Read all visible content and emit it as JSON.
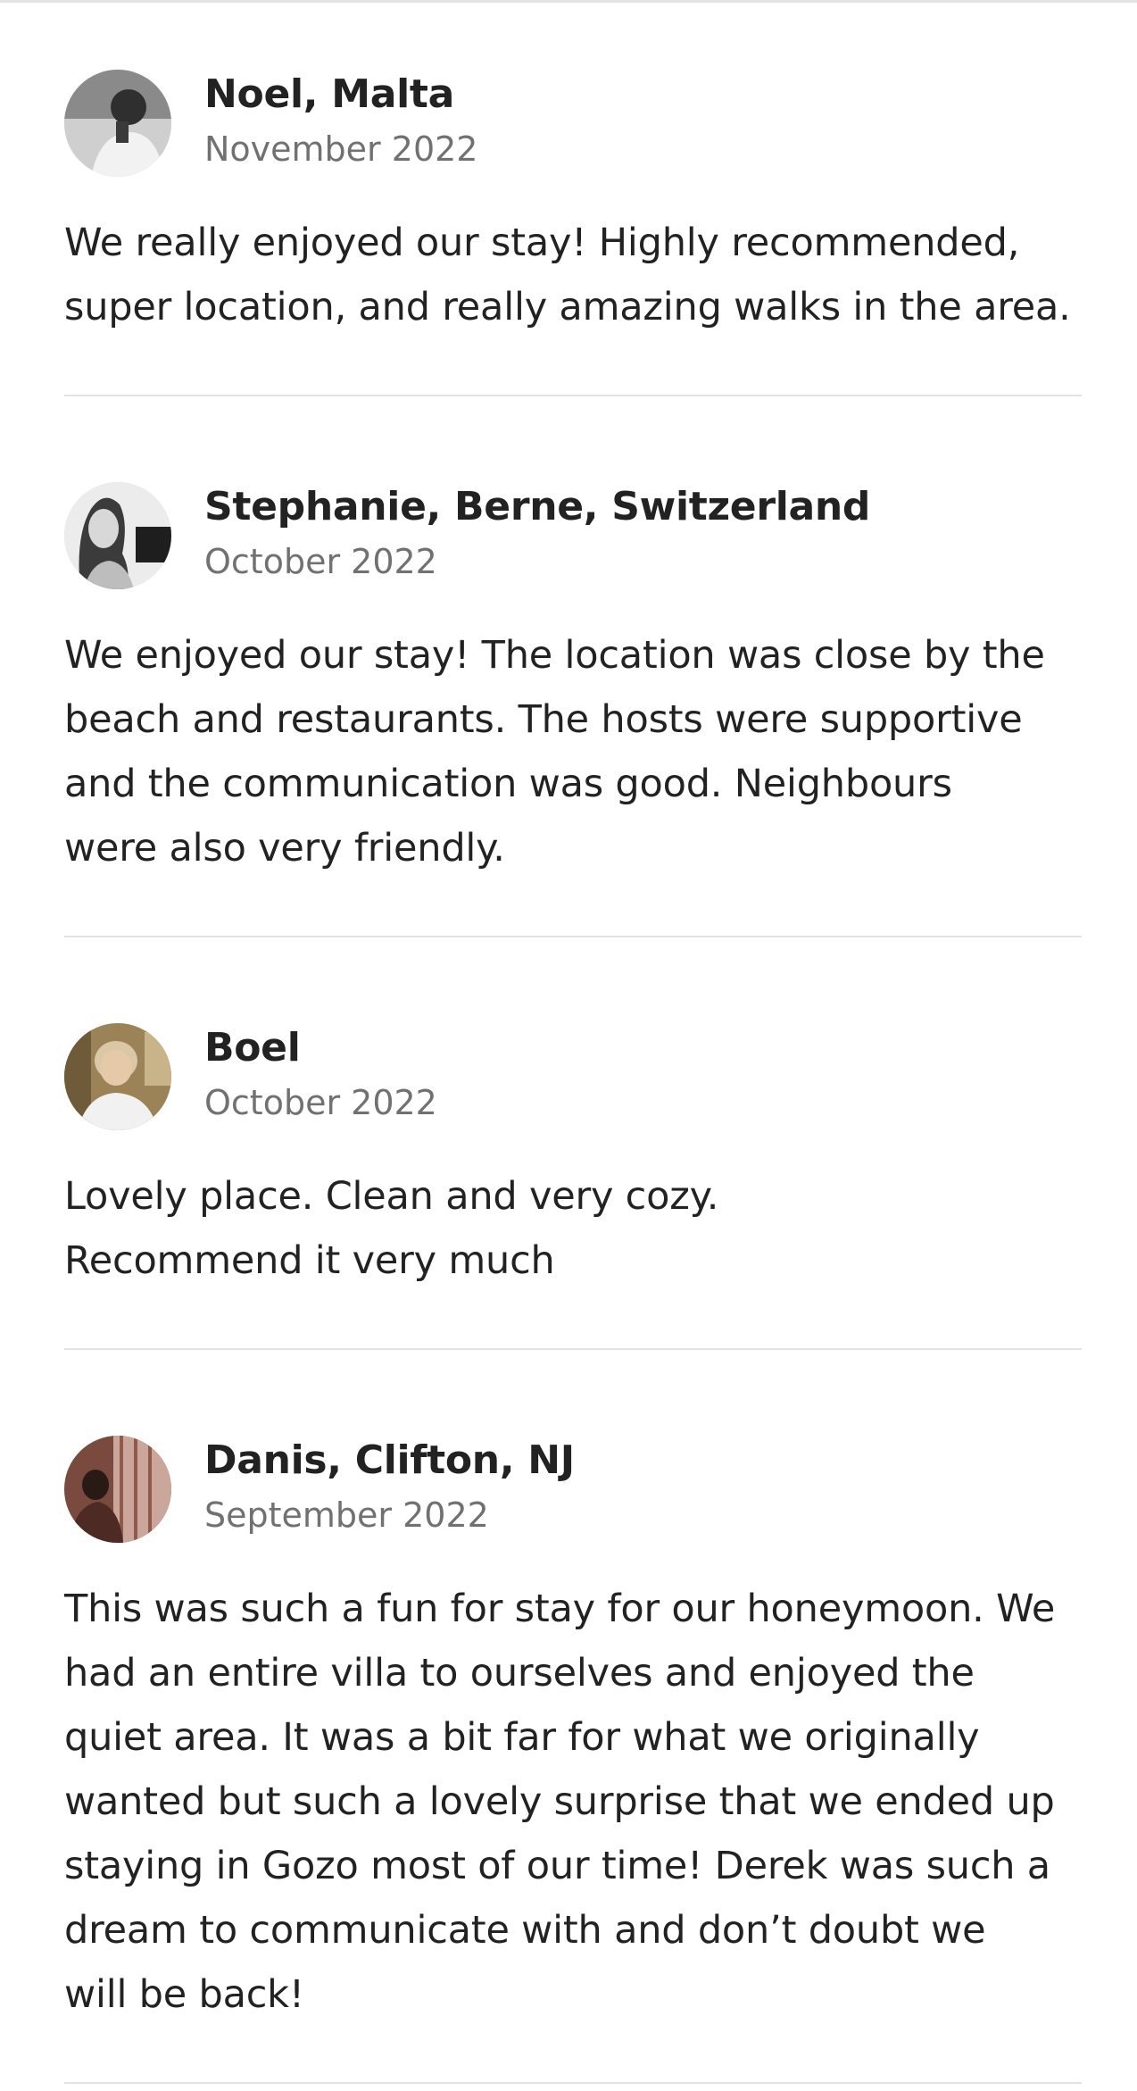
{
  "reviews": [
    {
      "name": "Noel, Malta",
      "date": "November 2022",
      "text": "We really enjoyed our stay! Highly recommended,\nsuper location, and really amazing walks in the area.",
      "avatar_colors": {
        "bg": "#d9d9d9",
        "figure": "#3a3a3a"
      }
    },
    {
      "name": "Stephanie, Berne, Switzerland",
      "date": "October 2022",
      "text": "We enjoyed our stay! The location was close by the\nbeach and restaurants. The hosts were supportive\nand the communication was good. Neighbours\nwere also very friendly.",
      "avatar_colors": {
        "bg": "#e6e6e6",
        "figure": "#4a4a4a"
      }
    },
    {
      "name": "Boel",
      "date": "October 2022",
      "text": "Lovely place. Clean and very cozy.\nRecommend it very much",
      "avatar_colors": {
        "bg": "#a88c5e",
        "figure": "#e8d2b4"
      }
    },
    {
      "name": "Danis, Clifton, NJ",
      "date": "September 2022",
      "text": "This was such a fun for stay for our honeymoon. We\nhad an entire villa to ourselves and enjoyed the\nquiet area. It was a bit far for what we originally\nwanted but such a lovely surprise that we ended up\nstaying in Gozo most of our time! Derek was such a\ndream to communicate with and don’t doubt we\nwill be back!",
      "avatar_colors": {
        "bg": "#6b3e35",
        "figure": "#2a1a16"
      }
    }
  ],
  "colors": {
    "text_primary": "#222222",
    "text_secondary": "#717171",
    "divider": "#e2e2e2"
  }
}
